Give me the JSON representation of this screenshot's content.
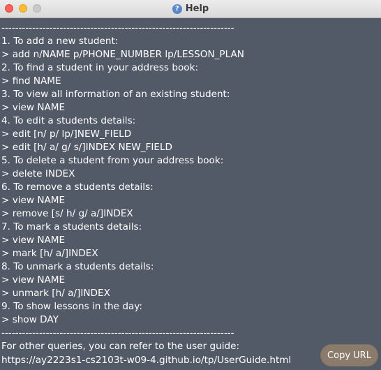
{
  "window": {
    "title": "Help",
    "icon": "help-question-icon"
  },
  "help_lines": [
    "--------------------------------------------------------------------",
    "1. To add a new student:",
    "> add n/NAME p/PHONE_NUMBER lp/LESSON_PLAN",
    "2. To find a student in your address book:",
    "> find NAME",
    "3. To view all information of an existing student:",
    "> view NAME",
    "4. To edit a students details:",
    "> edit [n/ p/ lp/]NEW_FIELD",
    "> edit [h/ a/ g/ s/]INDEX NEW_FIELD",
    "5. To delete a student from your address book:",
    "> delete INDEX",
    "6. To remove a students details:",
    "> view NAME",
    "> remove [s/ h/ g/ a/]INDEX",
    "7. To mark a students details:",
    "> view NAME",
    "> mark [h/ a/]INDEX",
    "8. To unmark a students details:",
    "> view NAME",
    "> unmark [h/ a/]INDEX",
    "9. To show lessons in the day:",
    "> show DAY",
    "--------------------------------------------------------------------"
  ],
  "footer": {
    "text": "For other queries, you can refer to the user guide:",
    "url": "https://ay2223s1-cs2103t-w09-4.github.io/tp/UserGuide.html"
  },
  "copy_button_label": "Copy URL"
}
